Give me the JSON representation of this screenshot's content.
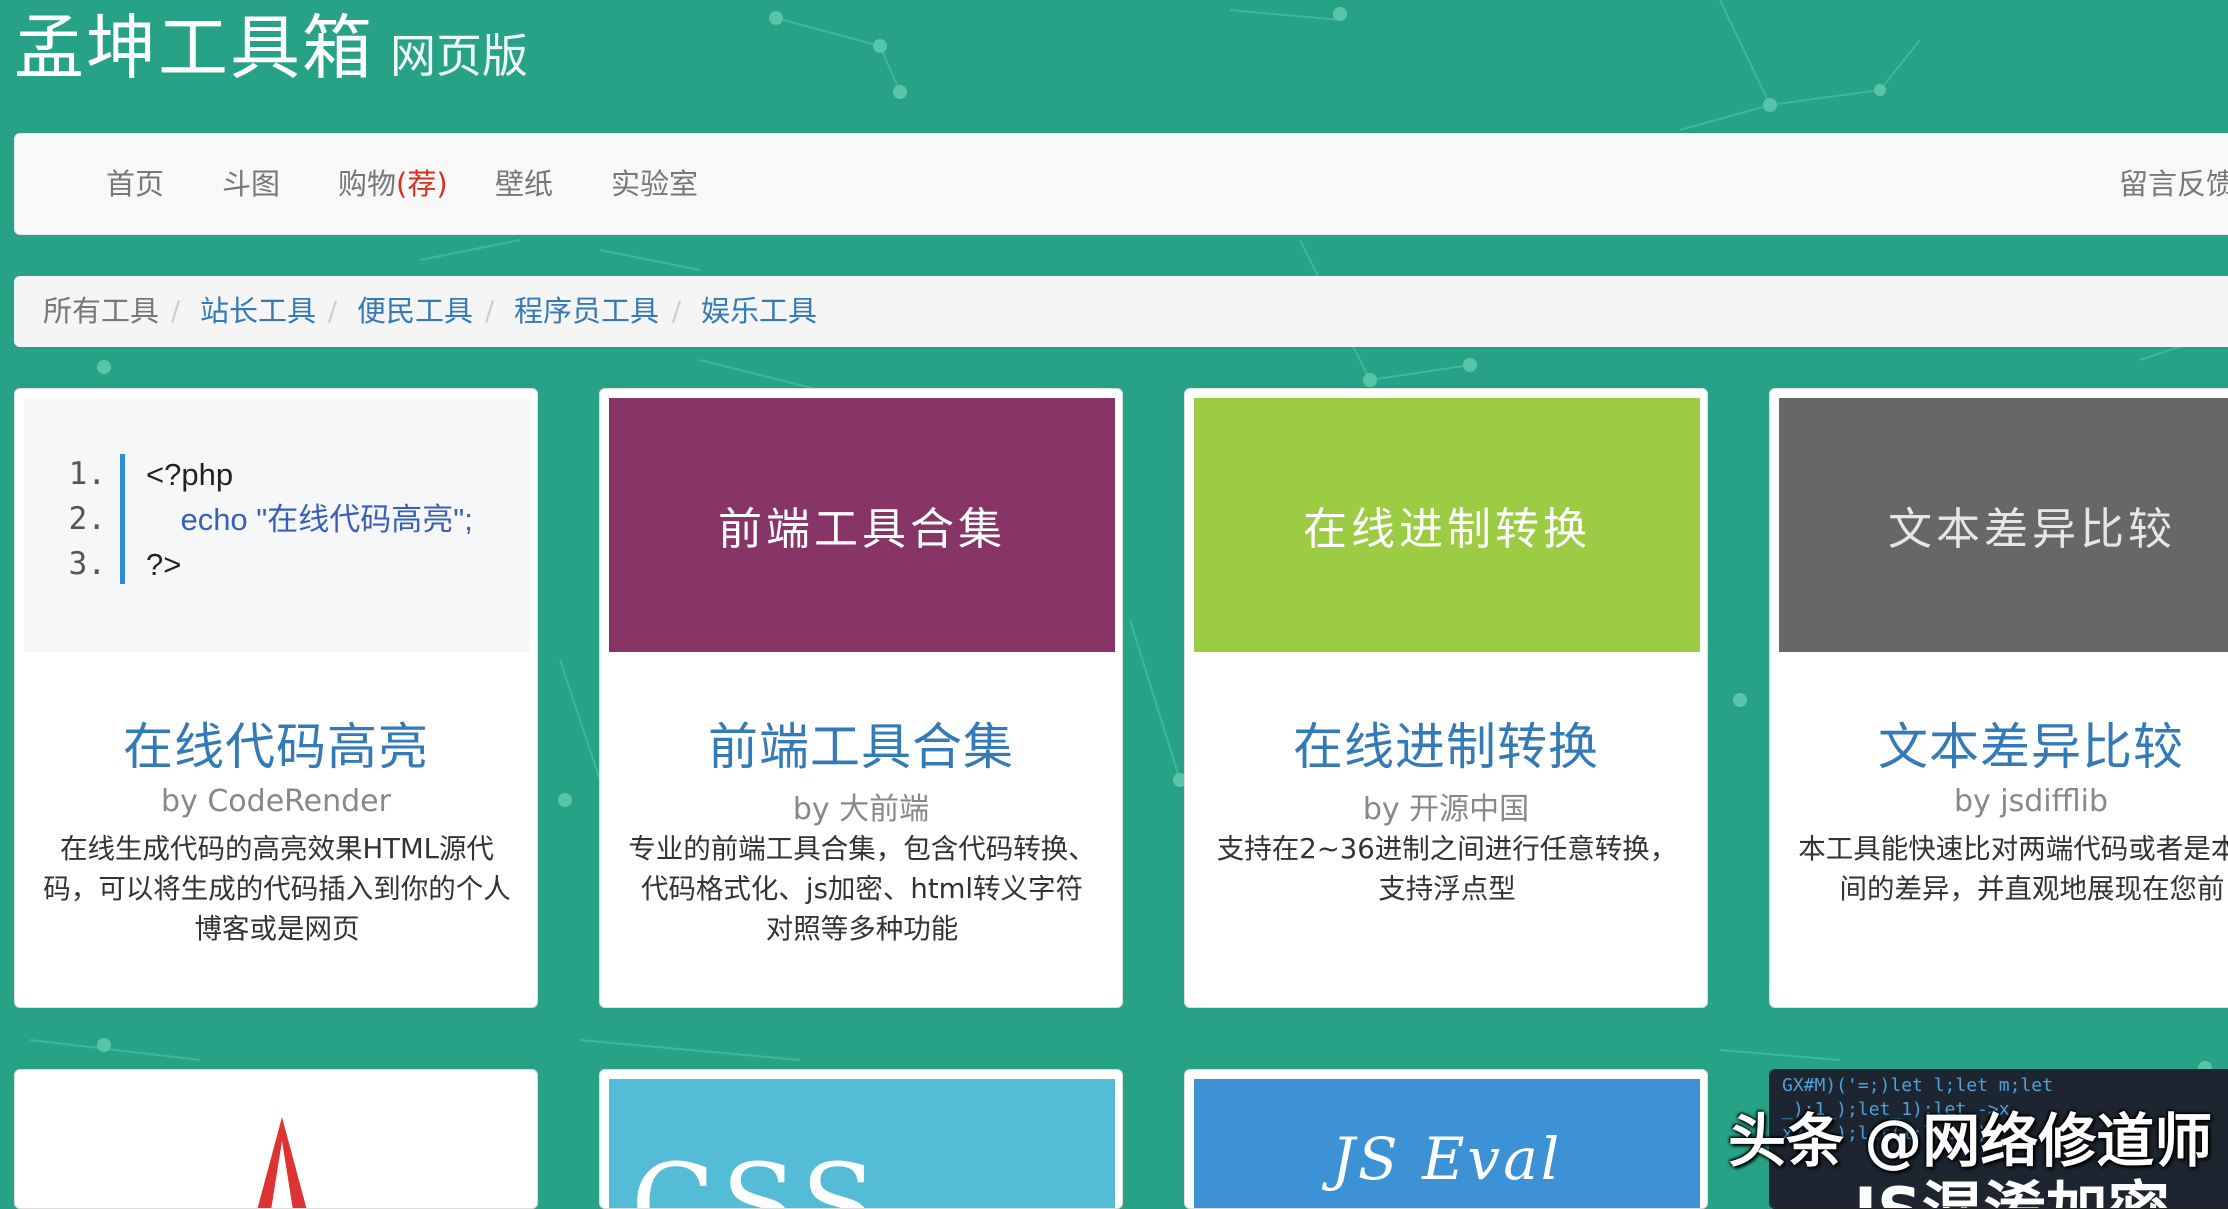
{
  "site": {
    "title": "孟坤工具箱",
    "subtitle": "网页版"
  },
  "nav": {
    "items": [
      {
        "label": "首页"
      },
      {
        "label": "斗图"
      },
      {
        "label": "购物",
        "badge": "(荐)"
      },
      {
        "label": "壁纸"
      },
      {
        "label": "实验室"
      }
    ],
    "right_label": "留言反馈"
  },
  "breadcrumb": {
    "items": [
      "所有工具",
      "站长工具",
      "便民工具",
      "程序员工具",
      "娱乐工具"
    ],
    "separator": "/"
  },
  "cards": [
    {
      "title": "在线代码高亮",
      "author": "by CodeRender",
      "desc": "在线生成代码的高亮效果HTML源代码，可以将生成的代码插入到你的个人博客或是网页",
      "thumb": {
        "type": "code",
        "line_numbers": [
          "1.",
          "2.",
          "3."
        ],
        "lines": [
          "<?php",
          "    echo \"在线代码高亮\";",
          "?>"
        ]
      }
    },
    {
      "title": "前端工具合集",
      "author": "by 大前端",
      "desc": "专业的前端工具合集，包含代码转换、代码格式化、js加密、html转义字符对照等多种功能",
      "thumb": {
        "type": "banner",
        "text": "前端工具合集",
        "bg": "#873466",
        "fg": "#ffffff"
      }
    },
    {
      "title": "在线进制转换",
      "author": "by 开源中国",
      "desc": "支持在2~36进制之间进行任意转换，支持浮点型",
      "thumb": {
        "type": "banner",
        "text": "在线进制转换",
        "bg": "#9ccc43",
        "fg": "#ffffff"
      }
    },
    {
      "title": "文本差异比较",
      "author": "by jsdifflib",
      "desc": "本工具能快速比对两端代码或者是本之间的差异，并直观地展现在您前",
      "thumb": {
        "type": "banner",
        "text": "文本差异比较",
        "bg": "#676767",
        "fg": "#e6e6e6"
      }
    }
  ],
  "cards_row2": [
    {
      "thumb_bg": "#ffffff",
      "thumb_text": "",
      "accent": "#dd3333"
    },
    {
      "thumb_bg": "#54bcd6",
      "thumb_text": "CSS"
    },
    {
      "thumb_bg": "#3c92d5",
      "thumb_text": "JS Eval"
    },
    {
      "thumb_bg": "#1c2530",
      "thumb_text": "JS混淆加密"
    }
  ],
  "watermark": "头条 @网络修道师",
  "colors": {
    "background": "#27a287",
    "link": "#337ab7",
    "muted": "#777777",
    "badge_red": "#d9301e"
  }
}
